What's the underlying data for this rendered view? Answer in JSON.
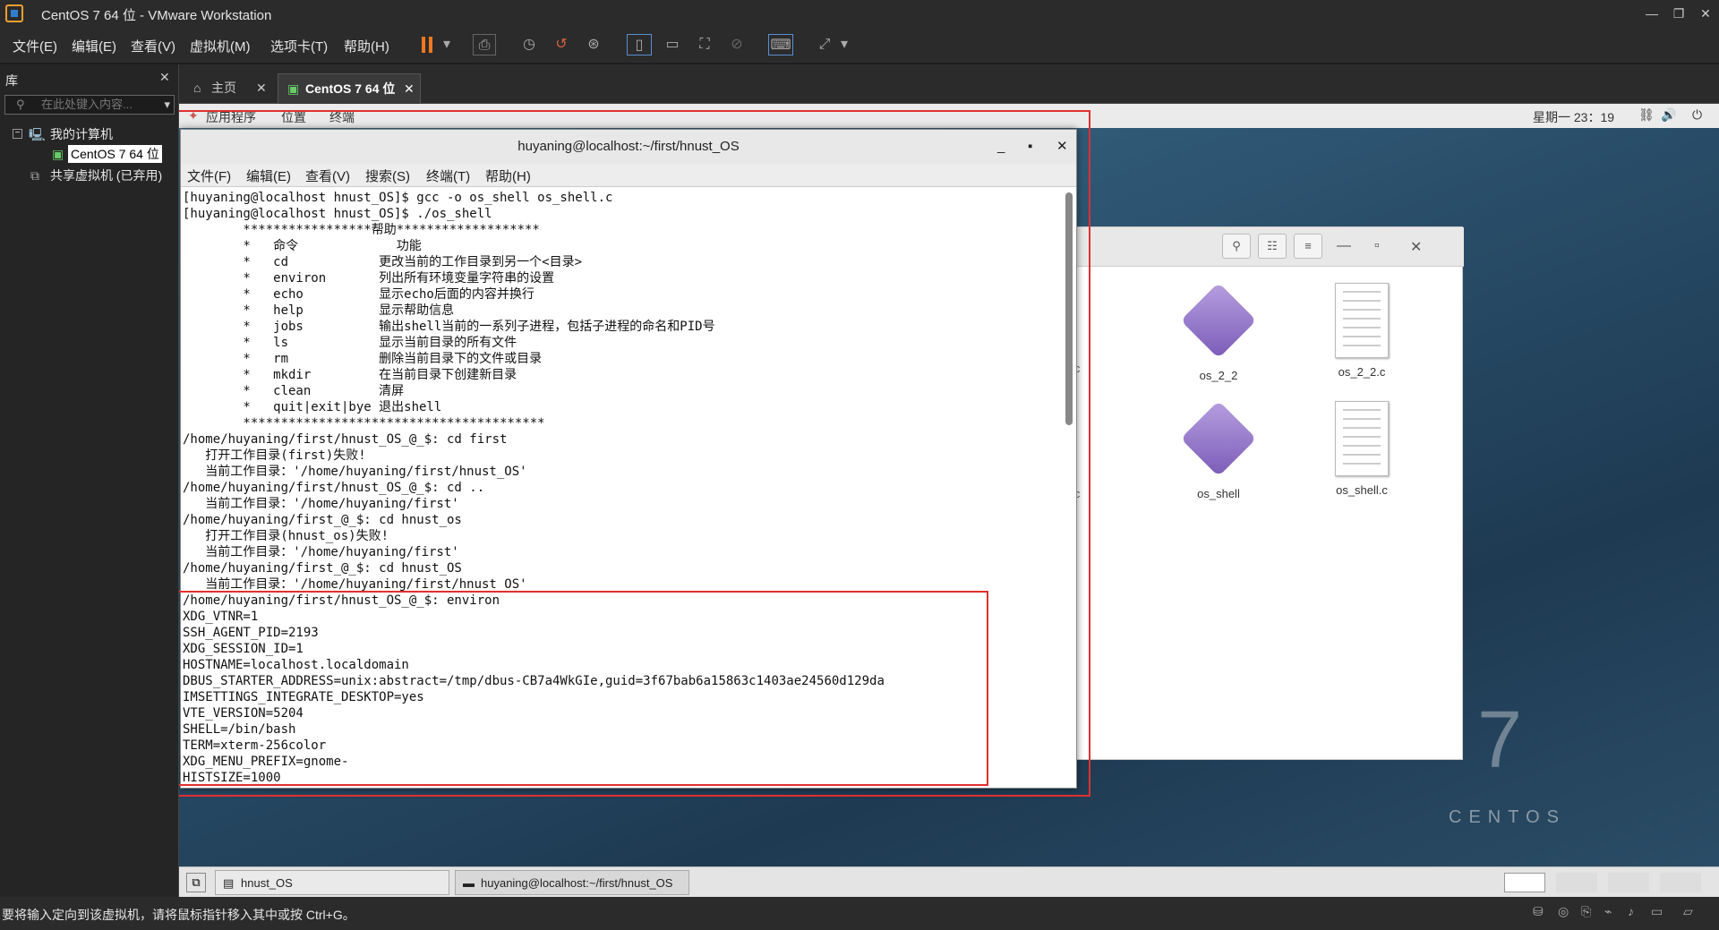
{
  "window": {
    "title": "CentOS 7 64 位 - VMware Workstation",
    "min": "—",
    "restore": "❐",
    "close": "✕"
  },
  "menu": [
    "文件(E)",
    "编辑(E)",
    "查看(V)",
    "虚拟机(M)",
    "选项卡(T)",
    "帮助(H)"
  ],
  "library": {
    "title": "库",
    "close": "✕",
    "search_placeholder": "在此处键入内容...",
    "my_computer": "我的计算机",
    "vm": "CentOS 7 64 位",
    "shared": "共享虚拟机 (已弃用)"
  },
  "tabs": [
    {
      "label": "主页",
      "close": "✕"
    },
    {
      "label": "CentOS 7 64 位",
      "close": "✕"
    }
  ],
  "guest_top": {
    "apps": "应用程序",
    "places": "位置",
    "terminal": "终端",
    "clock": "星期一 23：19"
  },
  "file_manager": {
    "files": [
      {
        "name": "os_2_2"
      },
      {
        "name": "os_2_2.c"
      },
      {
        "name": "os_shell"
      },
      {
        "name": "os_shell.c"
      }
    ],
    "partial1": "2.c",
    "partial2": "3.c"
  },
  "terminal": {
    "title": "huyaning@localhost:~/first/hnust_OS",
    "menu": [
      "文件(F)",
      "编辑(E)",
      "查看(V)",
      "搜索(S)",
      "终端(T)",
      "帮助(H)"
    ],
    "lines": [
      "[huyaning@localhost hnust_OS]$ gcc -o os_shell os_shell.c",
      "[huyaning@localhost hnust_OS]$ ./os_shell",
      "        *****************帮助*******************",
      "        *   命令             功能",
      "        *   cd            更改当前的工作目录到另一个<目录>",
      "        *   environ       列出所有环境变量字符串的设置",
      "        *   echo          显示echo后面的内容并换行",
      "        *   help          显示帮助信息",
      "        *   jobs          输出shell当前的一系列子进程，包括子进程的命名和PID号",
      "        *   ls            显示当前目录的所有文件",
      "        *   rm            删除当前目录下的文件或目录",
      "        *   mkdir         在当前目录下创建新目录",
      "        *   clean         清屏",
      "        *   quit|exit|bye 退出shell",
      "        ****************************************",
      "/home/huyaning/first/hnust_OS_@_$: cd first",
      "   打开工作目录(first)失败!",
      "   当前工作目录：'/home/huyaning/first/hnust_OS'",
      "/home/huyaning/first/hnust_OS_@_$: cd ..",
      "   当前工作目录：'/home/huyaning/first'",
      "/home/huyaning/first_@_$: cd hnust_os",
      "   打开工作目录(hnust_os)失败!",
      "   当前工作目录：'/home/huyaning/first'",
      "/home/huyaning/first_@_$: cd hnust_OS",
      "   当前工作目录：'/home/huyaning/first/hnust_OS'",
      "/home/huyaning/first/hnust_OS_@_$: environ",
      "XDG_VTNR=1",
      "SSH_AGENT_PID=2193",
      "XDG_SESSION_ID=1",
      "HOSTNAME=localhost.localdomain",
      "DBUS_STARTER_ADDRESS=unix:abstract=/tmp/dbus-CB7a4WkGIe,guid=3f67bab6a15863c1403ae24560d129da",
      "IMSETTINGS_INTEGRATE_DESKTOP=yes",
      "VTE_VERSION=5204",
      "SHELL=/bin/bash",
      "TERM=xterm-256color",
      "XDG_MENU_PREFIX=gnome-",
      "HISTSIZE=1000"
    ]
  },
  "brand": {
    "number": "7",
    "name": "CENTOS"
  },
  "guest_taskbar": {
    "item1": "hnust_OS",
    "item2": "huyaning@localhost:~/first/hnust_OS"
  },
  "status": "要将输入定向到该虚拟机，请将鼠标指针移入其中或按 Ctrl+G。",
  "colors": {
    "highlight": "#e03030",
    "accent": "#f07820"
  }
}
